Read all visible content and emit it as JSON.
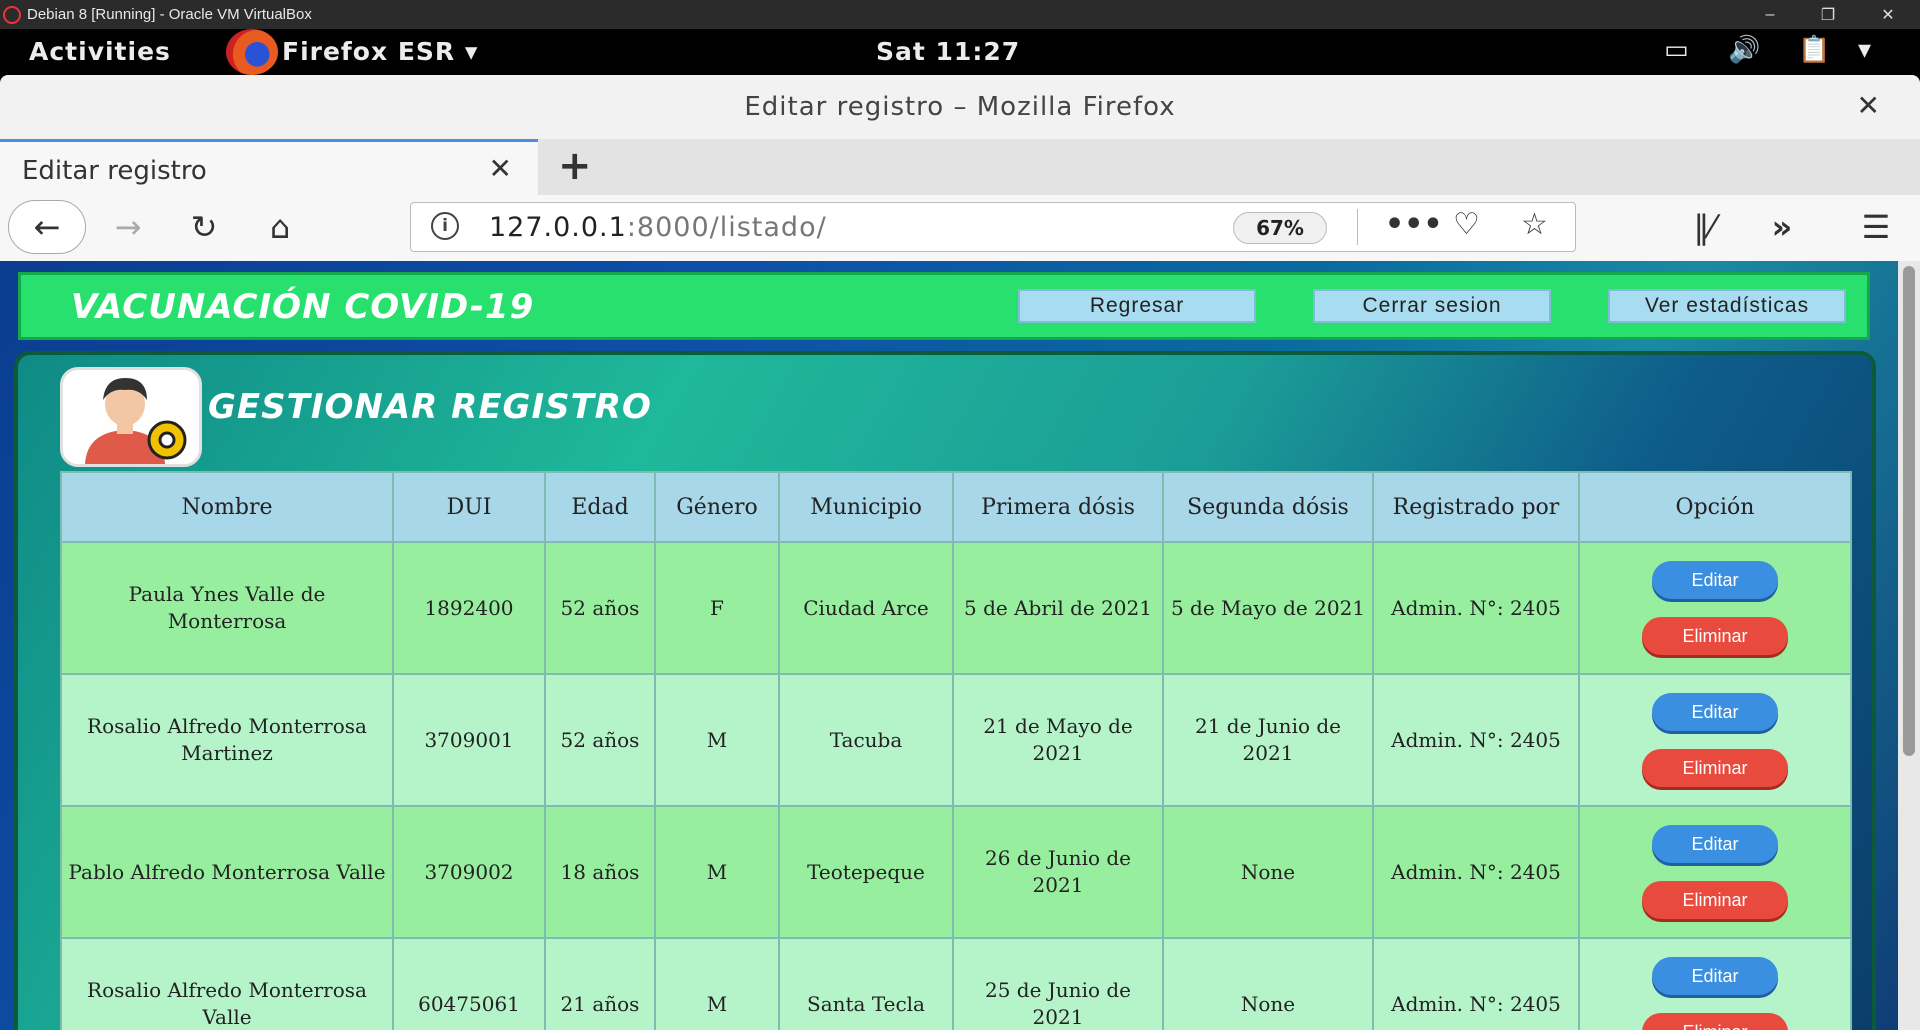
{
  "vbox": {
    "title": "Debian 8 [Running] - Oracle VM VirtualBox"
  },
  "gnome": {
    "activities": "Activities",
    "app_name": "Firefox ESR",
    "clock": "Sat 11:27"
  },
  "firefox": {
    "window_title": "Editar registro – Mozilla Firefox",
    "tab_label": "Editar registro",
    "url_host": "127.0.0.1",
    "url_rest": ":8000/listado/",
    "zoom": "67%"
  },
  "header": {
    "brand": "VACUNACIÓN COVID-19",
    "buttons": [
      "Regresar",
      "Cerrar sesion",
      "Ver estadísticas"
    ]
  },
  "panel": {
    "title": "GESTIONAR REGISTRO"
  },
  "table": {
    "columns": [
      "Nombre",
      "DUI",
      "Edad",
      "Género",
      "Municipio",
      "Primera dósis",
      "Segunda dósis",
      "Registrado por",
      "Opción"
    ],
    "edit_label": "Editar",
    "delete_label": "Eliminar",
    "rows": [
      {
        "nombre": "Paula Ynes Valle de Monterrosa",
        "dui": "1892400",
        "edad": "52 años",
        "genero": "F",
        "municipio": "Ciudad Arce",
        "primera": "5 de Abril de 2021",
        "segunda": "5 de Mayo de 2021",
        "registrado": "Admin. N°: 2405"
      },
      {
        "nombre": "Rosalio Alfredo Monterrosa Martinez",
        "dui": "3709001",
        "edad": "52 años",
        "genero": "M",
        "municipio": "Tacuba",
        "primera": "21 de Mayo de 2021",
        "segunda": "21 de Junio de 2021",
        "registrado": "Admin. N°: 2405"
      },
      {
        "nombre": "Pablo Alfredo Monterrosa Valle",
        "dui": "3709002",
        "edad": "18 años",
        "genero": "M",
        "municipio": "Teotepeque",
        "primera": "26 de Junio de 2021",
        "segunda": "None",
        "registrado": "Admin. N°: 2405"
      },
      {
        "nombre": "Rosalio Alfredo Monterrosa Valle",
        "dui": "60475061",
        "edad": "21 años",
        "genero": "M",
        "municipio": "Santa Tecla",
        "primera": "25 de Junio de 2021",
        "segunda": "None",
        "registrado": "Admin. N°: 2405"
      }
    ]
  }
}
